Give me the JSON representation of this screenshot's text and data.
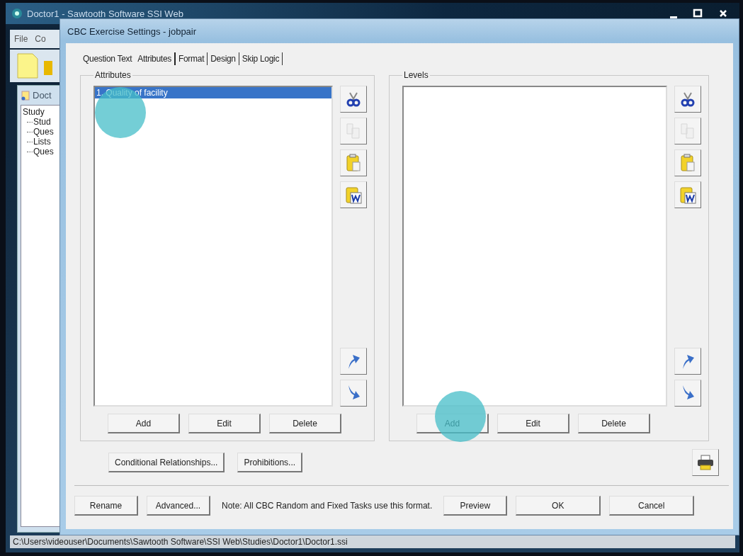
{
  "main_window": {
    "title": "Doctor1 - Sawtooth Software SSI Web",
    "menu": [
      "File",
      "Co"
    ],
    "panel_title": "Doct",
    "tree": [
      {
        "label": "Study",
        "children": [
          {
            "label": "Stud"
          },
          {
            "label": "Ques"
          },
          {
            "label": "Lists"
          },
          {
            "label": "Ques"
          }
        ]
      }
    ],
    "status_bar": "C:\\Users\\videouser\\Documents\\Sawtooth Software\\SSI Web\\Studies\\Doctor1\\Doctor1.ssi"
  },
  "dialog": {
    "title": "CBC Exercise Settings - jobpair",
    "tabs": [
      {
        "label": "Question Text",
        "selected": false
      },
      {
        "label": "Attributes",
        "selected": true
      },
      {
        "label": "Format",
        "selected": false
      },
      {
        "label": "Design",
        "selected": false
      },
      {
        "label": "Skip Logic",
        "selected": false
      }
    ],
    "panels": [
      {
        "title": "Attributes",
        "items": [
          {
            "label": "1. Quality of facility",
            "selected": true
          }
        ],
        "tools": [
          {
            "kind": "cut",
            "disabled": false
          },
          {
            "kind": "copy",
            "disabled": true
          },
          {
            "kind": "paste",
            "disabled": false
          },
          {
            "kind": "word",
            "disabled": false
          }
        ],
        "moves": [
          {
            "kind": "up"
          },
          {
            "kind": "down"
          }
        ],
        "buttons": [
          "Add",
          "Edit",
          "Delete"
        ],
        "click_highlight_on_item": true,
        "click_highlight_on_add": false
      },
      {
        "title": "Levels",
        "tools": [
          {
            "kind": "cut",
            "disabled": false
          },
          {
            "kind": "copy",
            "disabled": true
          },
          {
            "kind": "paste",
            "disabled": false
          },
          {
            "kind": "word",
            "disabled": false
          }
        ],
        "moves": [
          {
            "kind": "up"
          },
          {
            "kind": "down"
          }
        ],
        "buttons": [
          "Add",
          "Edit",
          "Delete"
        ],
        "click_highlight_on_item": false,
        "click_highlight_on_add": true
      }
    ],
    "extra_buttons": [
      "Conditional Relationships...",
      "Prohibitions..."
    ],
    "footer": {
      "buttons_left": [
        "Rename",
        "Advanced..."
      ],
      "note": "Note:  All CBC Random and Fixed Tasks use this format.",
      "buttons_right": [
        "Preview",
        "OK",
        "Cancel"
      ]
    }
  }
}
